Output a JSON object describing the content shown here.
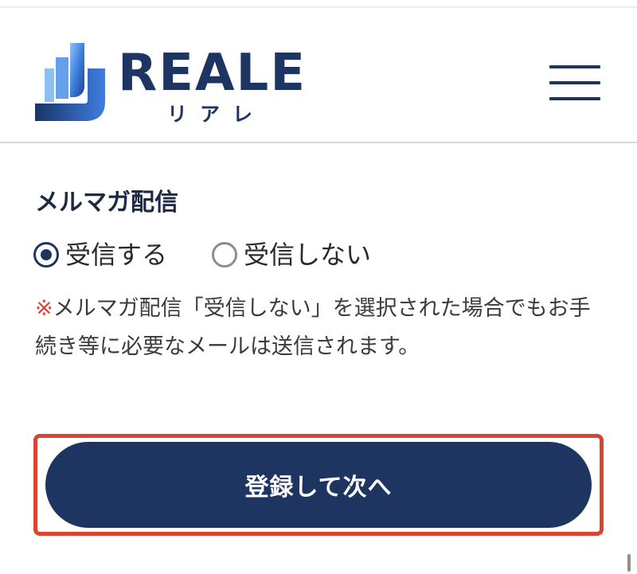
{
  "header": {
    "logo_word": "REALE",
    "logo_kana": "リアレ",
    "menu_icon": "hamburger-menu-icon"
  },
  "newsletter": {
    "title": "メルマガ配信",
    "options": [
      {
        "label": "受信する",
        "selected": true
      },
      {
        "label": "受信しない",
        "selected": false
      }
    ],
    "notice_mark": "※",
    "notice_text": "メルマガ配信「受信しない」を選択された場合でもお手続き等に必要なメールは送信されます。"
  },
  "submit": {
    "label": "登録して次へ"
  },
  "colors": {
    "brand_navy": "#1f3561",
    "highlight_red": "#d9452e",
    "notice_red": "#e0433a"
  }
}
